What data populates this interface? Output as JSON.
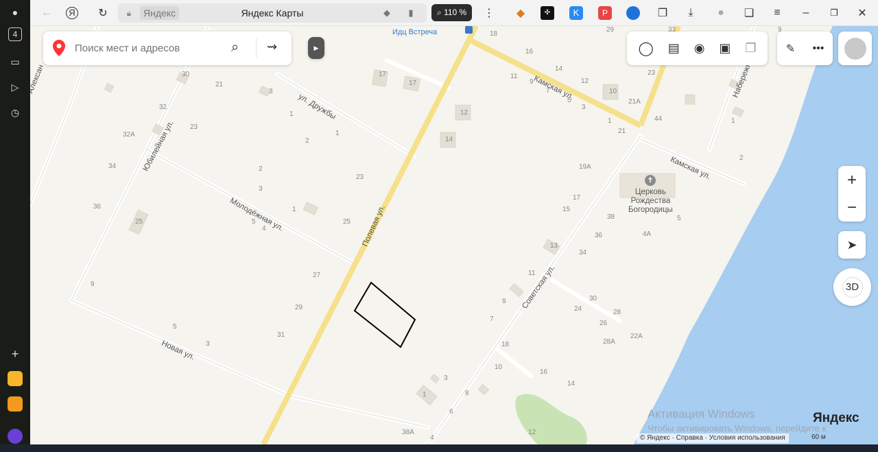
{
  "browser": {
    "site": "Яндекс",
    "title": "Яндекс Карты",
    "zoom": "110 %",
    "tab_count": "4"
  },
  "search": {
    "placeholder": "Поиск мест и адресов"
  },
  "map": {
    "poi_top": "Идц Встреча",
    "church": [
      "Церковь",
      "Рождества",
      "Богородицы"
    ],
    "streets": {
      "polevaya": "Полевая ул.",
      "kamskaya1": "Камская ул.",
      "kamskaya2": "Камская ул.",
      "druzhby": "ул. Дружбы",
      "molodezhnaya": "Молодёжная ул.",
      "yubileynaya": "Юбилейная ул.",
      "novaya": "Новая ул.",
      "sovetskaya": "Советская ул.",
      "naberezhnaya": "Набережн",
      "alexandr": "Алексан"
    },
    "houses": [
      "30",
      "21",
      "3",
      "32",
      "23",
      "32А",
      "34",
      "36",
      "25",
      "9",
      "5",
      "3",
      "2",
      "1",
      "2",
      "1",
      "3",
      "5",
      "4",
      "1",
      "25",
      "23",
      "27",
      "29",
      "31",
      "17",
      "17",
      "12",
      "14",
      "18",
      "16",
      "11",
      "9",
      "7",
      "14",
      "12",
      "5",
      "3",
      "10",
      "21А",
      "1",
      "21",
      "23",
      "44",
      "1",
      "19А",
      "17",
      "15",
      "38",
      "36",
      "13",
      "34",
      "11",
      "9",
      "7",
      "18",
      "10",
      "16",
      "14",
      "8",
      "6",
      "4",
      "3",
      "1",
      "12",
      "38А",
      "30",
      "28",
      "24",
      "26",
      "28А",
      "22А",
      "4А",
      "5",
      "2",
      "33",
      "29",
      "9"
    ]
  },
  "controls": {
    "zoom_in": "+",
    "zoom_out": "−",
    "mode_3d": "3D"
  },
  "watermark": {
    "title": "Активация Windows",
    "text": "Чтобы активировать Windows, перейдите к"
  },
  "brand": "Яндекс",
  "footer": {
    "copyright": "© Яндекс",
    "help": "Справка",
    "terms": "Условия использования",
    "scale": "60 м"
  }
}
